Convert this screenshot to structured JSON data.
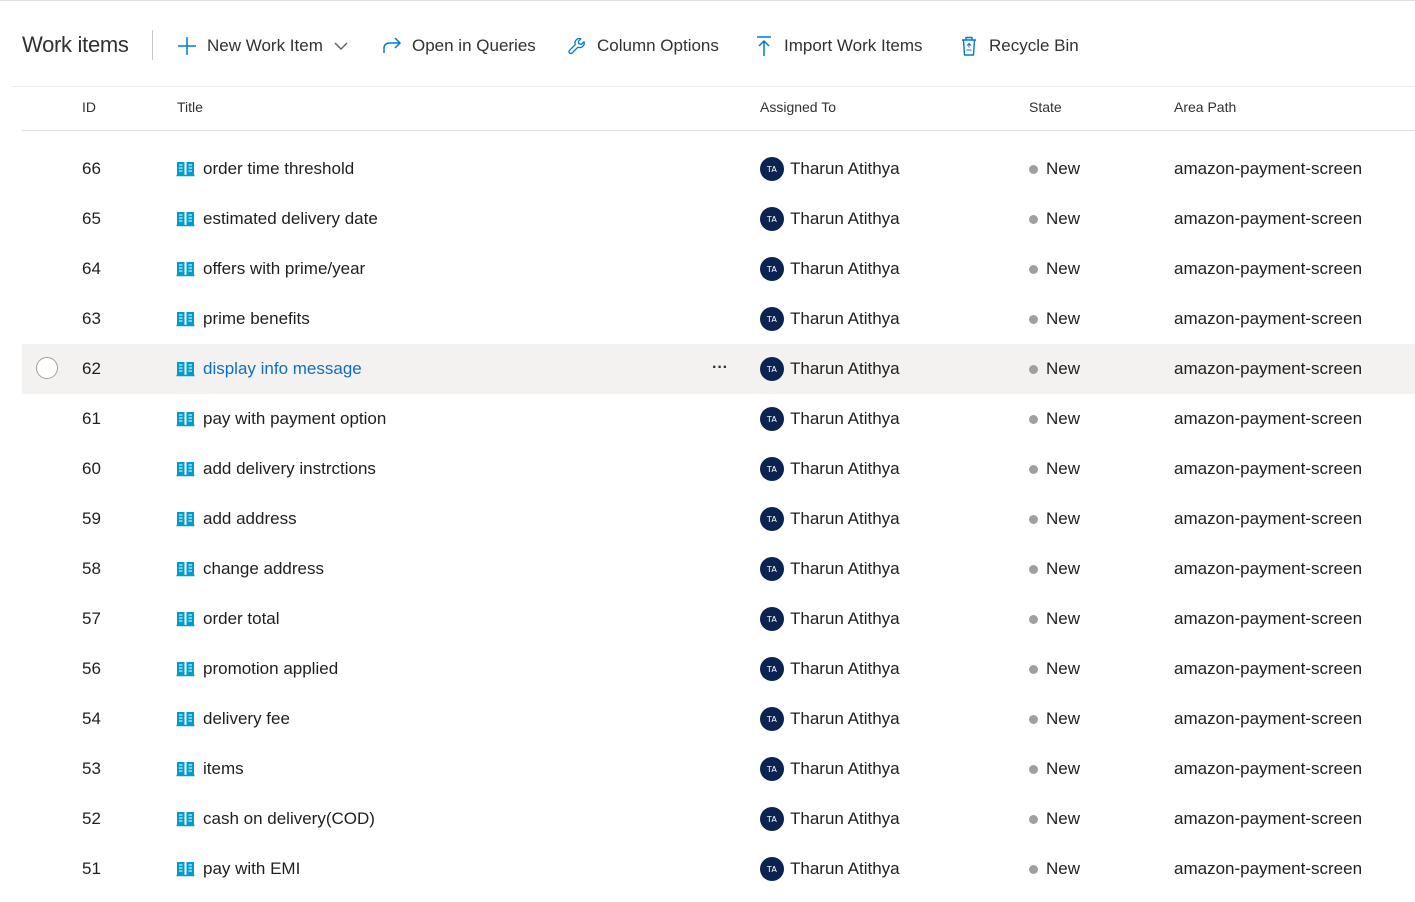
{
  "header": {
    "title": "Work items",
    "toolbar": {
      "new_work_item": "New Work Item",
      "open_in_queries": "Open in Queries",
      "column_options": "Column Options",
      "import_work_items": "Import Work Items",
      "recycle_bin": "Recycle Bin"
    }
  },
  "columns": {
    "id": "ID",
    "title": "Title",
    "assigned_to": "Assigned To",
    "state": "State",
    "area_path": "Area Path"
  },
  "rows": [
    {
      "id": "66",
      "title": "order time threshold",
      "initials": "TA",
      "assigned": "Tharun Atithya",
      "state": "New",
      "area": "amazon-payment-screen"
    },
    {
      "id": "65",
      "title": "estimated delivery date",
      "initials": "TA",
      "assigned": "Tharun Atithya",
      "state": "New",
      "area": "amazon-payment-screen"
    },
    {
      "id": "64",
      "title": "offers with prime/year",
      "initials": "TA",
      "assigned": "Tharun Atithya",
      "state": "New",
      "area": "amazon-payment-screen"
    },
    {
      "id": "63",
      "title": "prime benefits",
      "initials": "TA",
      "assigned": "Tharun Atithya",
      "state": "New",
      "area": "amazon-payment-screen"
    },
    {
      "id": "62",
      "title": "display info message",
      "initials": "TA",
      "assigned": "Tharun Atithya",
      "state": "New",
      "area": "amazon-payment-screen",
      "more": "···"
    },
    {
      "id": "61",
      "title": "pay with payment option",
      "initials": "TA",
      "assigned": "Tharun Atithya",
      "state": "New",
      "area": "amazon-payment-screen"
    },
    {
      "id": "60",
      "title": "add delivery instrctions",
      "initials": "TA",
      "assigned": "Tharun Atithya",
      "state": "New",
      "area": "amazon-payment-screen"
    },
    {
      "id": "59",
      "title": "add address",
      "initials": "TA",
      "assigned": "Tharun Atithya",
      "state": "New",
      "area": "amazon-payment-screen"
    },
    {
      "id": "58",
      "title": "change address",
      "initials": "TA",
      "assigned": "Tharun Atithya",
      "state": "New",
      "area": "amazon-payment-screen"
    },
    {
      "id": "57",
      "title": "order total",
      "initials": "TA",
      "assigned": "Tharun Atithya",
      "state": "New",
      "area": "amazon-payment-screen"
    },
    {
      "id": "56",
      "title": "promotion applied",
      "initials": "TA",
      "assigned": "Tharun Atithya",
      "state": "New",
      "area": "amazon-payment-screen"
    },
    {
      "id": "54",
      "title": "delivery fee",
      "initials": "TA",
      "assigned": "Tharun Atithya",
      "state": "New",
      "area": "amazon-payment-screen"
    },
    {
      "id": "53",
      "title": "items",
      "initials": "TA",
      "assigned": "Tharun Atithya",
      "state": "New",
      "area": "amazon-payment-screen"
    },
    {
      "id": "52",
      "title": "cash on delivery(COD)",
      "initials": "TA",
      "assigned": "Tharun Atithya",
      "state": "New",
      "area": "amazon-payment-screen"
    },
    {
      "id": "51",
      "title": "pay with EMI",
      "initials": "TA",
      "assigned": "Tharun Atithya",
      "state": "New",
      "area": "amazon-payment-screen"
    }
  ],
  "icons": {
    "new": "plus-icon",
    "new_dropdown": "chevron-down-icon",
    "open_queries": "redo-arrow-icon",
    "column_options": "wrench-icon",
    "import": "upload-arrow-icon",
    "recycle_bin": "recycle-bin-icon",
    "work_item": "user-story-book-icon",
    "state": "status-dot-icon"
  },
  "colors": {
    "accent": "#0078d4",
    "link": "#106ebe",
    "avatar": "#0b2350",
    "state_new": "#a19f9d",
    "row_highlight": "#f3f2f1",
    "book_icon": "#009ccc"
  }
}
